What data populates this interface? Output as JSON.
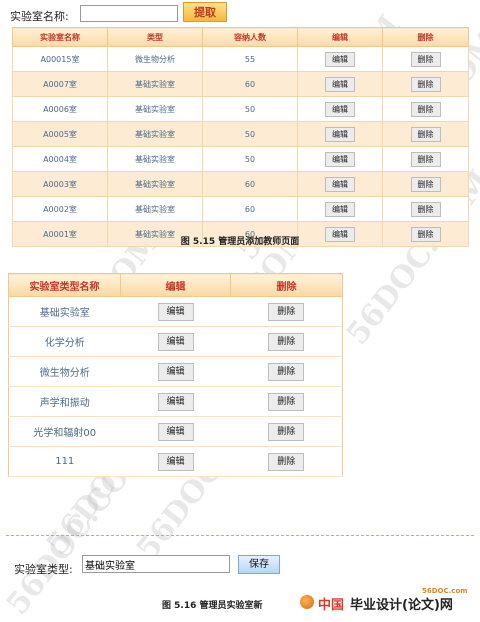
{
  "search": {
    "label": "实验室名称:",
    "value": "",
    "button": "提取"
  },
  "lab_table": {
    "headers": [
      "实验室名称",
      "类型",
      "容纳人数",
      "编辑",
      "删除"
    ],
    "rows": [
      {
        "name": "A00015室",
        "type": "微生物分析",
        "capacity": "55",
        "edit": "编辑",
        "delete": "删除"
      },
      {
        "name": "A0007室",
        "type": "基础实验室",
        "capacity": "60",
        "edit": "编辑",
        "delete": "删除"
      },
      {
        "name": "A0006室",
        "type": "基础实验室",
        "capacity": "50",
        "edit": "编辑",
        "delete": "删除"
      },
      {
        "name": "A0005室",
        "type": "基础实验室",
        "capacity": "50",
        "edit": "编辑",
        "delete": "删除"
      },
      {
        "name": "A0004室",
        "type": "基础实验室",
        "capacity": "50",
        "edit": "编辑",
        "delete": "删除"
      },
      {
        "name": "A0003室",
        "type": "基础实验室",
        "capacity": "60",
        "edit": "编辑",
        "delete": "删除"
      },
      {
        "name": "A0002室",
        "type": "基础实验室",
        "capacity": "60",
        "edit": "编辑",
        "delete": "删除"
      },
      {
        "name": "A0001室",
        "type": "基础实验室",
        "capacity": "60",
        "edit": "编辑",
        "delete": "删除"
      }
    ]
  },
  "caption1": "图 5.15 管理员添加教师页面",
  "type_table": {
    "headers": [
      "实验室类型名称",
      "编辑",
      "删除"
    ],
    "rows": [
      {
        "name": "基础实验室",
        "edit": "编辑",
        "delete": "删除"
      },
      {
        "name": "化学分析",
        "edit": "编辑",
        "delete": "删除"
      },
      {
        "name": "微生物分析",
        "edit": "编辑",
        "delete": "删除"
      },
      {
        "name": "声学和振动",
        "edit": "编辑",
        "delete": "删除"
      },
      {
        "name": "光学和辐射00",
        "edit": "编辑",
        "delete": "删除"
      },
      {
        "name": "111",
        "edit": "编辑",
        "delete": "删除"
      }
    ]
  },
  "type_form": {
    "label": "实验室类型:",
    "value": "基础实验室",
    "button": "保存"
  },
  "caption2": "图 5.16 管理员实验室新",
  "logo": {
    "site": "56DOC.com",
    "cn": "中国",
    "title": "毕业设计(论文)网"
  },
  "watermark": "56DOC.COM",
  "colors": {
    "header_text": "#c0392b",
    "row_alt": "#fdebd3",
    "accent_orange": "#f5b93c"
  }
}
